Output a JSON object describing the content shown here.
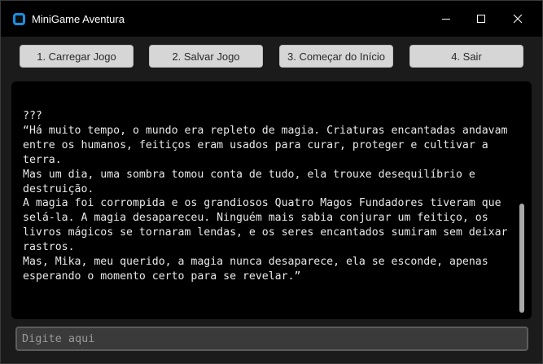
{
  "window": {
    "title": "MiniGame Aventura",
    "icon": "app-window-icon",
    "controls": [
      "minimize-icon",
      "maximize-icon",
      "close-icon"
    ]
  },
  "toolbar": {
    "buttons": [
      {
        "label": "1. Carregar Jogo"
      },
      {
        "label": "2. Salvar Jogo"
      },
      {
        "label": "3. Começar do Início"
      },
      {
        "label": "4. Sair"
      }
    ]
  },
  "story": {
    "text": "???\n“Há muito tempo, o mundo era repleto de magia. Criaturas encantadas andavam entre os humanos, feitiços eram usados para curar, proteger e cultivar a terra.\nMas um dia, uma sombra tomou conta de tudo, ela trouxe desequilíbrio e destruição.\nA magia foi corrompida e os grandiosos Quatro Magos Fundadores tiveram que selá-la. A magia desapareceu. Ninguém mais sabia conjurar um feitiço, os livros mágicos se tornaram lendas, e os seres encantados sumiram sem deixar rastros.\nMas, Mika, meu querido, a magia nunca desaparece, ela se esconde, apenas esperando o momento certo para se revelar.”"
  },
  "input": {
    "value": "",
    "placeholder": "Digite aqui"
  },
  "colors": {
    "background": "#1b1b1b",
    "text_area": "#000000",
    "button": "#d6d6d6",
    "accent": "#1a8fe0"
  }
}
